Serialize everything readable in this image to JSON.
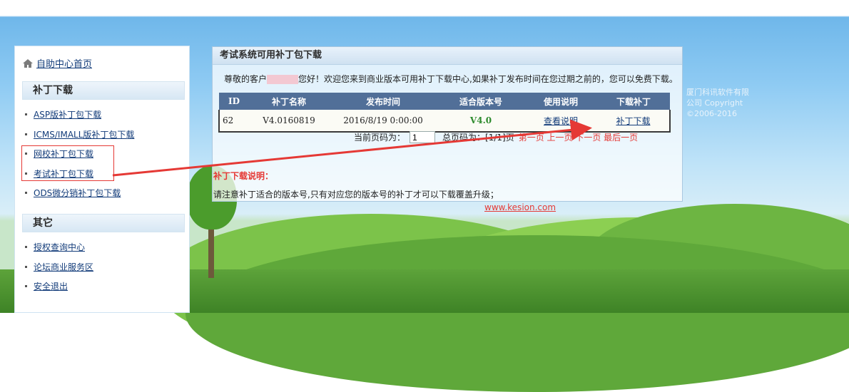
{
  "sidebar": {
    "home_label": "自助中心首页",
    "section_patch": "补丁下载",
    "patch_items": [
      "ASP版补丁包下载",
      "ICMS/IMALL版补丁包下载",
      "网校补丁包下载",
      "考试补丁包下载",
      "ODS微分销补丁包下载"
    ],
    "section_other": "其它",
    "other_items": [
      "授权查询中心",
      "论坛商业服务区",
      "安全退出"
    ]
  },
  "panel": {
    "title": "考试系统可用补丁包下载",
    "welcome_prefix": "尊敬的客户",
    "welcome_suffix": "您好！欢迎您来到商业版本可用补丁下载中心,如果补丁发布时间在您过期之前的，您可以免费下载。",
    "table": {
      "headers": [
        "ID",
        "补丁名称",
        "发布时间",
        "适合版本号",
        "使用说明",
        "下载补丁"
      ],
      "rows": [
        {
          "id": "62",
          "name": "V4.0160819",
          "date": "2016/8/19 0:00:00",
          "version": "V4.0",
          "guide": "查看说明",
          "download": "补丁下载"
        }
      ]
    },
    "pager": {
      "current_label": "当前页码为：",
      "current_value": "1",
      "total_text": "总页码为：[1/1]页",
      "nav": "第一页 上一页 下一页 最后一页"
    }
  },
  "notes": {
    "title": "补丁下载说明：",
    "body": "请注意补丁适合的版本号,只有对应您的版本号的补丁才可以下载覆盖升级；",
    "site": "www.kesion.com"
  },
  "copyright": {
    "line1": "厦门科讯软件有限",
    "line2": "公司 Copyright",
    "line3": "©2006-2016"
  },
  "colors": {
    "table_header": "#516f98",
    "annotation_red": "#e53935",
    "link_blue": "#133c7a"
  }
}
